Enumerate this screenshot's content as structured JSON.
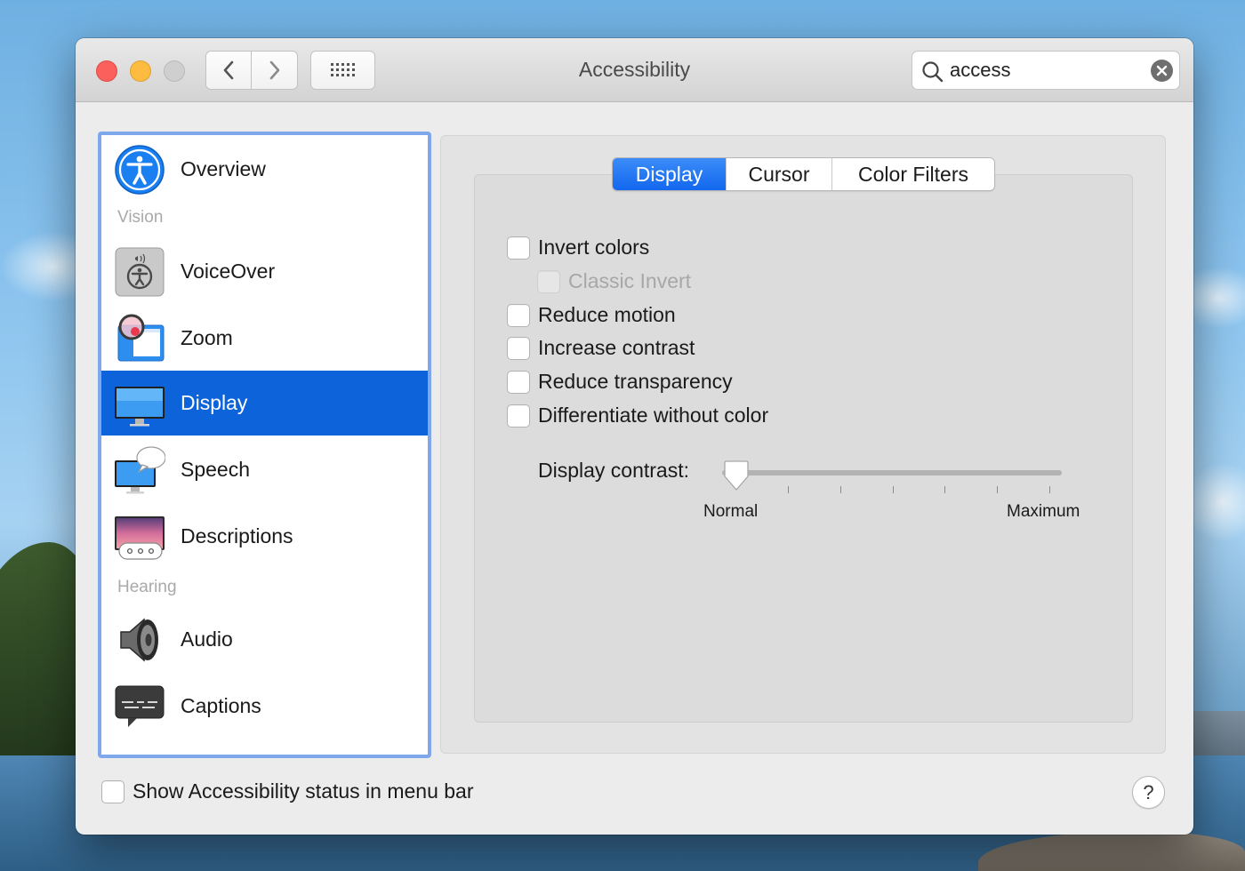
{
  "window": {
    "title": "Accessibility",
    "search": {
      "value": "access",
      "icon": "magnifier-icon",
      "clear_icon": "clear-x-icon"
    }
  },
  "sidebar": {
    "sections": [
      "Vision",
      "Hearing"
    ],
    "items": [
      {
        "label": "Overview",
        "icon": "accessibility-person-icon",
        "selected": false
      },
      {
        "label": "VoiceOver",
        "icon": "voiceover-icon",
        "selected": false
      },
      {
        "label": "Zoom",
        "icon": "zoom-magnifier-icon",
        "selected": false
      },
      {
        "label": "Display",
        "icon": "monitor-icon",
        "selected": true
      },
      {
        "label": "Speech",
        "icon": "speech-bubble-monitor-icon",
        "selected": false
      },
      {
        "label": "Descriptions",
        "icon": "descriptions-icon",
        "selected": false
      },
      {
        "label": "Audio",
        "icon": "speaker-icon",
        "selected": false
      },
      {
        "label": "Captions",
        "icon": "captions-icon",
        "selected": false
      }
    ]
  },
  "tabs": [
    {
      "label": "Display",
      "active": true
    },
    {
      "label": "Cursor",
      "active": false
    },
    {
      "label": "Color Filters",
      "active": false
    }
  ],
  "options": [
    {
      "label": "Invert colors",
      "checked": false,
      "disabled": false
    },
    {
      "label": "Classic Invert",
      "checked": false,
      "disabled": true
    },
    {
      "label": "Reduce motion",
      "checked": false,
      "disabled": false
    },
    {
      "label": "Increase contrast",
      "checked": false,
      "disabled": false
    },
    {
      "label": "Reduce transparency",
      "checked": false,
      "disabled": false
    },
    {
      "label": "Differentiate without color",
      "checked": false,
      "disabled": false
    }
  ],
  "contrast": {
    "label": "Display contrast:",
    "min_label": "Normal",
    "max_label": "Maximum",
    "value": 0
  },
  "footer": {
    "status_checkbox_label": "Show Accessibility status in menu bar",
    "status_checked": false,
    "help_label": "?"
  },
  "colors": {
    "selection": "#0d63d9",
    "active_tab": "#1a6cf0",
    "sidebar_focus_ring": "#7fa7ec"
  }
}
